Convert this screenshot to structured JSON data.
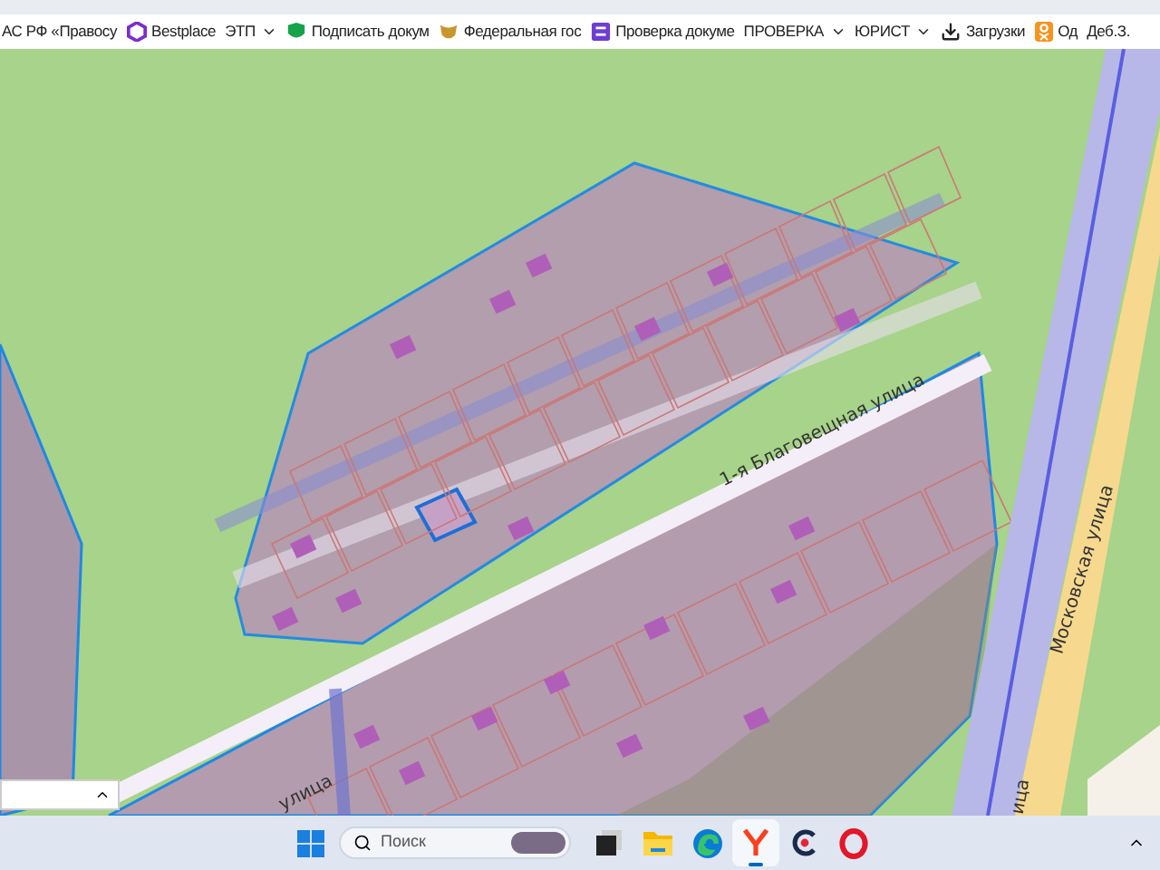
{
  "bookmarks": [
    {
      "label": "АС РФ «Правосу",
      "dropdown": false
    },
    {
      "label": "Bestplace",
      "dropdown": false
    },
    {
      "label": "ЭТП",
      "dropdown": true
    },
    {
      "label": "Подписать докум",
      "dropdown": false
    },
    {
      "label": "Федеральная гос",
      "dropdown": false
    },
    {
      "label": "Проверка докуме",
      "dropdown": false
    },
    {
      "label": "ПРОВЕРКА",
      "dropdown": true
    },
    {
      "label": "ЮРИСТ",
      "dropdown": true
    },
    {
      "label": "Загрузки",
      "dropdown": false
    },
    {
      "label": "Од",
      "dropdown": false
    },
    {
      "label": "Деб.З.",
      "dropdown": false
    }
  ],
  "map": {
    "street_labels": [
      "1-я Благовещная улица",
      "Московская улица",
      "улица",
      "ица"
    ]
  },
  "taskbar": {
    "search_placeholder": "Поиск",
    "apps": [
      {
        "kind": "taskview",
        "active": false
      },
      {
        "kind": "folder",
        "active": false
      },
      {
        "kind": "edge",
        "active": false
      },
      {
        "kind": "yandex",
        "active": true
      },
      {
        "kind": "c",
        "active": false
      },
      {
        "kind": "opera",
        "active": false
      }
    ]
  }
}
